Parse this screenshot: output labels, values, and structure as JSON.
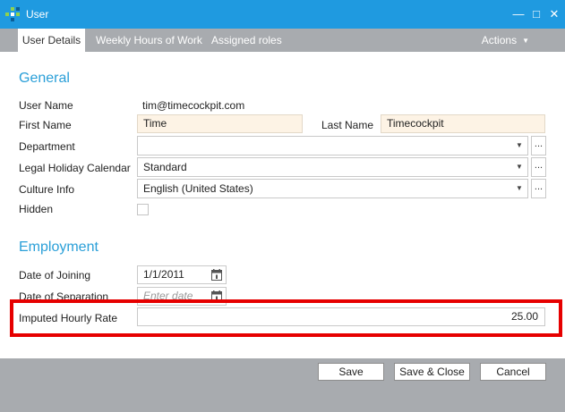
{
  "window": {
    "title": "User",
    "controls": {
      "minimize": "—",
      "maximize": "□",
      "close": "✕"
    }
  },
  "tabs": [
    {
      "label": "User Details",
      "active": true
    },
    {
      "label": "Weekly Hours of Work",
      "active": false
    },
    {
      "label": "Assigned roles",
      "active": false
    }
  ],
  "actions": {
    "label": "Actions"
  },
  "general": {
    "title": "General",
    "user_name": {
      "label": "User Name",
      "value": "tim@timecockpit.com"
    },
    "first_name": {
      "label": "First Name",
      "value": "Time"
    },
    "last_name": {
      "label": "Last Name",
      "value": "Timecockpit"
    },
    "department": {
      "label": "Department",
      "value": "",
      "browse": "..."
    },
    "holiday_calendar": {
      "label": "Legal Holiday Calendar",
      "value": "Standard",
      "browse": "..."
    },
    "culture_info": {
      "label": "Culture Info",
      "value": "English (United States)",
      "browse": "..."
    },
    "hidden": {
      "label": "Hidden",
      "checked": false
    }
  },
  "employment": {
    "title": "Employment",
    "date_of_joining": {
      "label": "Date of Joining",
      "value": "1/1/2011"
    },
    "date_of_separation": {
      "label": "Date of Separation",
      "placeholder": "Enter date"
    },
    "hourly_rate": {
      "label": "Imputed Hourly Rate",
      "value": "25.00"
    }
  },
  "buttons": {
    "save": "Save",
    "save_close": "Save & Close",
    "cancel": "Cancel"
  },
  "colors": {
    "titlebar": "#1f9ae0",
    "accent": "#2a9fd8",
    "highlight": "#e60000",
    "chrome": "#a8abaf"
  }
}
